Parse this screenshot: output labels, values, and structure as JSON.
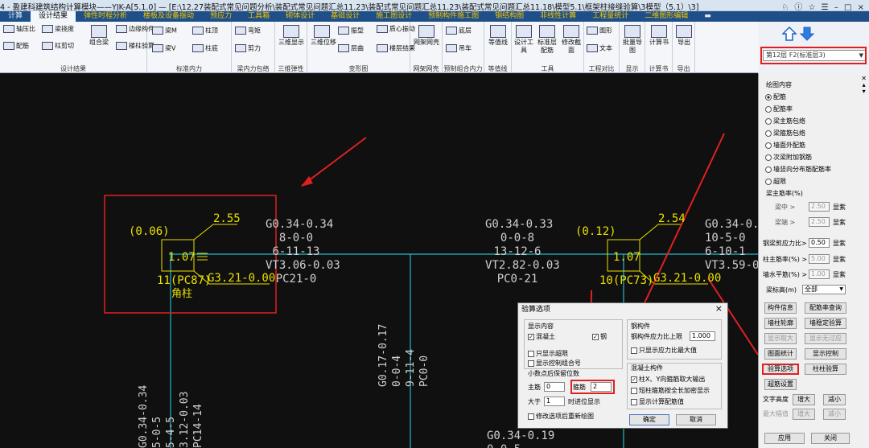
{
  "window": {
    "title": "4 - 盈建科建筑结构计算模块——YJK-A[5.1.0] — [E:\\12.27装配式常见问题分析\\装配式常见问题汇总11.23\\装配式常见问题汇总11.23\\装配式常见问题汇总11.18\\模型5.1\\框架柱接缝验算\\3模型（5.1）\\3]",
    "controls": "♘ ⓘ ☆ ☰  – □ ×"
  },
  "menu": {
    "tabs": [
      {
        "label": "计算",
        "style": "plain"
      },
      {
        "label": "设计结果",
        "style": "active"
      },
      {
        "label": "弹性时程分析",
        "style": "yel"
      },
      {
        "label": "楼板及设备振动",
        "style": "yel"
      },
      {
        "label": "预应力",
        "style": "yel"
      },
      {
        "label": "工具箱",
        "style": "yel"
      },
      {
        "label": "砌体设计",
        "style": "yel"
      },
      {
        "label": "基础设计",
        "style": "yel"
      },
      {
        "label": "施工图设计",
        "style": "yel"
      },
      {
        "label": "预制构件施工图",
        "style": "yel"
      },
      {
        "label": "钢结构图",
        "style": "yel"
      },
      {
        "label": "非线性计算",
        "style": "yel"
      },
      {
        "label": "工程量统计",
        "style": "yel"
      },
      {
        "label": "二维图形编辑",
        "style": "yel"
      },
      {
        "label": "▬",
        "style": "plain"
      }
    ]
  },
  "ribbon": {
    "g1": {
      "label": "设计结果",
      "b1": "轴压比",
      "b2": "配筋",
      "b3": "梁挠度",
      "b4": "柱剪切",
      "b5": "组合梁",
      "b6": "组合梁裂缝",
      "b7": "边缘构件",
      "b8": "楼柱验算"
    },
    "g2": {
      "label": "标准内力",
      "b1": "梁M",
      "b2": "梁V",
      "b3": "柱顶",
      "b4": "柱底"
    },
    "g3": {
      "label": "梁内力包络",
      "b1": "弯矩",
      "b2": "剪力"
    },
    "g4": {
      "label": "三维弹性",
      "b1": "三维显示"
    },
    "g5": {
      "label": "变形图",
      "b1": "三维位移",
      "b2": "振型",
      "b3": "层曲",
      "b4": "质心振动",
      "b5": "楼层结果"
    },
    "g6": {
      "label": "网架网壳",
      "b1": "网架网壳"
    },
    "g7": {
      "label": "预制组合内力",
      "b1": "底层",
      "b2": "吊车",
      "b3": "CR"
    },
    "g8": {
      "label": "等值线",
      "b1": "等值线"
    },
    "g9": {
      "label": "工具",
      "b1": "设计工具",
      "b2": "标准层配筋",
      "b3": "修改截面"
    },
    "g10": {
      "label": "工程对比",
      "b1": "图形",
      "b2": "文本"
    },
    "g11": {
      "label": "显示",
      "b1": "批量导图"
    },
    "g12": {
      "label": "计算书",
      "b1": "计算书"
    },
    "g13": {
      "label": "导出",
      "b1": "导出"
    }
  },
  "floor_select": {
    "value": "第12层 F2(标准层3)"
  },
  "canvas": {
    "left_col": {
      "ratio": "(0.06)",
      "val1": "2.55",
      "val2": "1.07",
      "label1": "11(PC87)",
      "label2": "G3.21-0.00",
      "corner": "角柱"
    },
    "right_col": {
      "ratio": "(0.12)",
      "val1": "2.54",
      "val2": "1.07",
      "label1": "10(PC73)",
      "label2": "G3.21-0.00"
    },
    "beam1": {
      "l1": "G0.34-0.34",
      "l2": "8-0-0",
      "l3": "6-11-13",
      "l4": "VT3.06-0.03",
      "l5": "PC21-0"
    },
    "beam2": {
      "l1": "G0.34-0.33",
      "l2": "0-0-8",
      "l3": "13-12-6",
      "l4": "VT2.82-0.03",
      "l5": "PC0-21"
    },
    "beam3": {
      "l1": "G0.34-0.",
      "l2": "10-5-0",
      "l3": "6-10-1",
      "l4": "VT3.59-0"
    },
    "vbeam1": {
      "l1": "G0.17-0.17",
      "l2": "0-0-4",
      "l3": "9-11-4",
      "l4": "PC0-0"
    },
    "vbeam2": {
      "l1": "G0.34-0.34",
      "l2": "5-0-5",
      "l3": "5-4-5",
      "l4": "3.12-0.03",
      "l5": "PC14-14"
    },
    "bottom": {
      "l1": "G0.34-0.19",
      "l2": "0-0-5"
    }
  },
  "dialog": {
    "title": "验算选项",
    "close": "×",
    "display_label": "显示内容",
    "concrete": "混凝土",
    "steel": "钢",
    "only_over": "只显示超限",
    "show_combo": "显示控制组合号",
    "decimals": "小数点后保留位数",
    "main_bar": "主筋",
    "main_bar_val": "0",
    "stirrup": "箍筋",
    "stirrup_val": "2",
    "greater": "大于",
    "greater_val": "1",
    "greater_suffix": "时进位显示",
    "redraw": "修改选项后重新绘图",
    "steel_member": "钢构件",
    "steel_limit": "钢构件应力比上限",
    "steel_limit_val": "1.000",
    "steel_only_max": "只显示应力比最大值",
    "conc_member": "混凝土构件",
    "xy_stirrup": "柱X、Y向箍筋取大输出",
    "joint_stirrup": "短柱箍筋按全长加密显示",
    "show_calc": "显示计算配筋值",
    "ok": "确定",
    "cancel": "取消"
  },
  "panel": {
    "group_title": "绘图内容",
    "radios": [
      {
        "label": "配筋",
        "on": true
      },
      {
        "label": "配筋率",
        "on": false
      },
      {
        "label": "梁主筋包络",
        "on": false
      },
      {
        "label": "梁箍筋包络",
        "on": false
      },
      {
        "label": "墙面外配筋",
        "on": false
      },
      {
        "label": "次梁附加钢筋",
        "on": false
      },
      {
        "label": "墙竖向分布筋配筋率",
        "on": false
      },
      {
        "label": "超限",
        "on": false
      }
    ],
    "beam_ratio": "梁主筋率(%)",
    "beam_mid": "梁中 >",
    "beam_mid_val": "2.50",
    "beam_end": "梁端 >",
    "beam_end_val": "2.50",
    "show": "显紫",
    "steel_ratio": "钢梁剪应力比>",
    "steel_ratio_val": "0.50",
    "col_ratio": "柱主筋率(%) >",
    "col_ratio_val": "5.00",
    "wall_ratio": "墙水平筋(%) >",
    "wall_ratio_val": "1.00",
    "elev": "梁标高(m)",
    "elev_val": "全部",
    "b_info": "构件信息",
    "b_query": "配筋率查询",
    "b_outline": "墙柱轮廓",
    "b_stable": "墙稳定验算",
    "b_max": "显示取大",
    "b_nocover": "显示无过应",
    "b_chart": "图面统计",
    "b_ctrl": "显示控制",
    "b_check": "验算选项",
    "b_colcheck": "柱柱验算",
    "b_super": "超筋设置",
    "b_textsize": "文字高度",
    "b_inc": "增大",
    "b_dec": "减小",
    "b_maxw": "最大幅值",
    "b_inc2": "增大",
    "b_dec2": "减小",
    "b_apply": "应用",
    "b_close": "关闭"
  }
}
